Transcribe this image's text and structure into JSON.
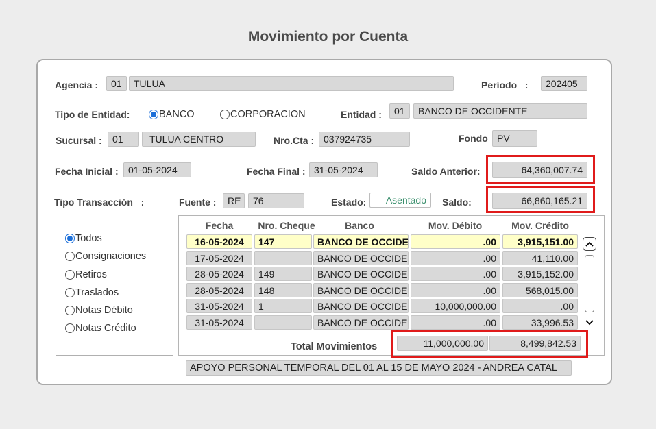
{
  "title": "Movimiento por Cuenta",
  "agencia": {
    "label": "Agencia",
    "sep": ":",
    "code": "01",
    "name": "TULUA"
  },
  "periodo": {
    "label": "Período",
    "sep": ":",
    "value": "202405"
  },
  "tipo_entidad": {
    "label": "Tipo de Entidad:",
    "options": [
      "BANCO",
      "CORPORACION"
    ],
    "selected": "BANCO"
  },
  "entidad": {
    "label": "Entidad",
    "sep": ":",
    "code": "01",
    "name": "BANCO DE OCCIDENTE"
  },
  "sucursal": {
    "label": "Sucursal",
    "sep": ":",
    "code": "01",
    "name": "TULUA CENTRO"
  },
  "nro_cta": {
    "label": "Nro.Cta",
    "sep": ":",
    "value": "037924735"
  },
  "fondo": {
    "label": "Fondo",
    "value": "PV"
  },
  "fecha_inicial": {
    "label": "Fecha Inicial",
    "sep": ":",
    "value": "01-05-2024"
  },
  "fecha_final": {
    "label": "Fecha Final",
    "sep": ":",
    "value": "31-05-2024"
  },
  "saldo_anterior": {
    "label": "Saldo Anterior:",
    "value": "64,360,007.74"
  },
  "tipo_transaccion": {
    "label": "Tipo Transacción",
    "sep": ":"
  },
  "fuente": {
    "label": "Fuente",
    "sep": ":",
    "code": "RE",
    "number": "76"
  },
  "estado": {
    "label": "Estado:",
    "value": "Asentado"
  },
  "saldo": {
    "label": "Saldo:",
    "value": "66,860,165.21"
  },
  "filters": {
    "options": [
      "Todos",
      "Consignaciones",
      "Retiros",
      "Traslados",
      "Notas Débito",
      "Notas Crédito"
    ],
    "selected": "Todos"
  },
  "grid": {
    "columns": [
      "Fecha",
      "Nro. Cheque",
      "Banco",
      "Mov. Débito",
      "Mov. Crédito"
    ],
    "rows": [
      {
        "fecha": "16-05-2024",
        "cheque": "147",
        "banco": "BANCO DE OCCIDENTE",
        "debito": ".00",
        "credito": "3,915,151.00"
      },
      {
        "fecha": "17-05-2024",
        "cheque": "",
        "banco": "BANCO DE OCCIDENTE",
        "debito": ".00",
        "credito": "41,110.00"
      },
      {
        "fecha": "28-05-2024",
        "cheque": "149",
        "banco": "BANCO DE OCCIDENTE",
        "debito": ".00",
        "credito": "3,915,152.00"
      },
      {
        "fecha": "28-05-2024",
        "cheque": "148",
        "banco": "BANCO DE OCCIDENTE",
        "debito": ".00",
        "credito": "568,015.00"
      },
      {
        "fecha": "31-05-2024",
        "cheque": "1",
        "banco": "BANCO DE OCCIDENTE",
        "debito": "10,000,000.00",
        "credito": ".00"
      },
      {
        "fecha": "31-05-2024",
        "cheque": "",
        "banco": "BANCO DE OCCIDENTE",
        "debito": ".00",
        "credito": "33,996.53"
      }
    ],
    "selected_row": 0
  },
  "totals": {
    "label": "Total Movimientos",
    "debito": "11,000,000.00",
    "credito": "8,499,842.53"
  },
  "description": "APOYO PERSONAL TEMPORAL DEL 01 AL 15 DE MAYO 2024 - ANDREA CATAL",
  "icons": {
    "scroll_up": "chevron-up-icon",
    "scroll_down": "chevron-down-icon"
  },
  "colors": {
    "highlight_border": "#e01b1b",
    "selected_row_bg": "#ffffc8",
    "radio_accent": "#1c6fd9",
    "estado_text": "#3a8f6d"
  }
}
